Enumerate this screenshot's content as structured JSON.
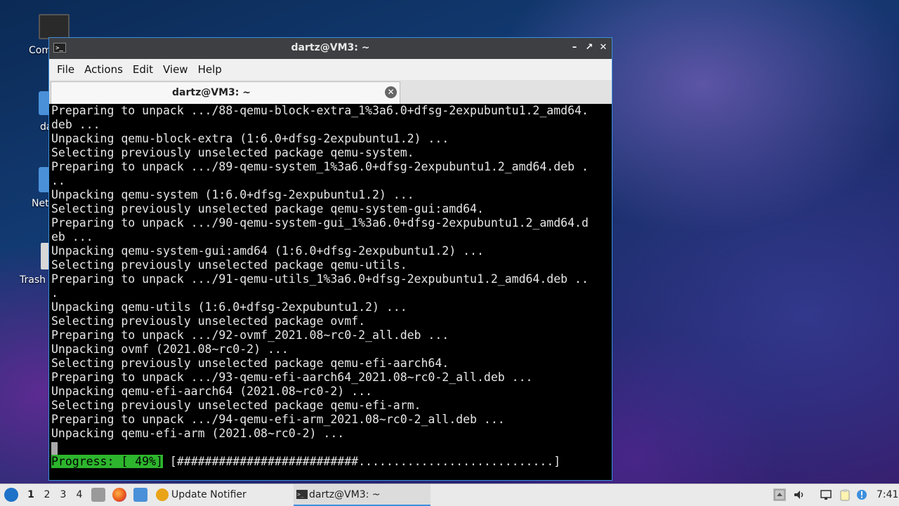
{
  "desktop": {
    "icons": [
      {
        "label": "Com"
      },
      {
        "label": "da"
      },
      {
        "label": "Net"
      },
      {
        "label": "Trash"
      }
    ]
  },
  "window": {
    "title": "dartz@VM3: ~",
    "controls": {
      "minimize": "–",
      "maximize": "↗",
      "close": "✕"
    },
    "menu": [
      "File",
      "Actions",
      "Edit",
      "View",
      "Help"
    ],
    "tab": {
      "label": "dartz@VM3: ~",
      "close": "✕"
    }
  },
  "terminal": {
    "lines": [
      "Preparing to unpack .../88-qemu-block-extra_1%3a6.0+dfsg-2expubuntu1.2_amd64.",
      "deb ...",
      "Unpacking qemu-block-extra (1:6.0+dfsg-2expubuntu1.2) ...",
      "Selecting previously unselected package qemu-system.",
      "Preparing to unpack .../89-qemu-system_1%3a6.0+dfsg-2expubuntu1.2_amd64.deb .",
      "..",
      "Unpacking qemu-system (1:6.0+dfsg-2expubuntu1.2) ...",
      "Selecting previously unselected package qemu-system-gui:amd64.",
      "Preparing to unpack .../90-qemu-system-gui_1%3a6.0+dfsg-2expubuntu1.2_amd64.d",
      "eb ...",
      "Unpacking qemu-system-gui:amd64 (1:6.0+dfsg-2expubuntu1.2) ...",
      "Selecting previously unselected package qemu-utils.",
      "Preparing to unpack .../91-qemu-utils_1%3a6.0+dfsg-2expubuntu1.2_amd64.deb ..",
      ".",
      "Unpacking qemu-utils (1:6.0+dfsg-2expubuntu1.2) ...",
      "Selecting previously unselected package ovmf.",
      "Preparing to unpack .../92-ovmf_2021.08~rc0-2_all.deb ...",
      "Unpacking ovmf (2021.08~rc0-2) ...",
      "Selecting previously unselected package qemu-efi-aarch64.",
      "Preparing to unpack .../93-qemu-efi-aarch64_2021.08~rc0-2_all.deb ...",
      "Unpacking qemu-efi-aarch64 (2021.08~rc0-2) ...",
      "Selecting previously unselected package qemu-efi-arm.",
      "Preparing to unpack .../94-qemu-efi-arm_2021.08~rc0-2_all.deb ...",
      "Unpacking qemu-efi-arm (2021.08~rc0-2) ..."
    ],
    "progress": {
      "label": "Progress: [ 49%]",
      "bar": " [##########################............................]",
      "percent": 49
    }
  },
  "taskbar": {
    "workspaces": [
      "1",
      "2",
      "3",
      "4"
    ],
    "active_workspace": "1",
    "tasks": {
      "notifier": "Update Notifier",
      "terminal": "dartz@VM3: ~"
    },
    "clock": "7:41"
  }
}
